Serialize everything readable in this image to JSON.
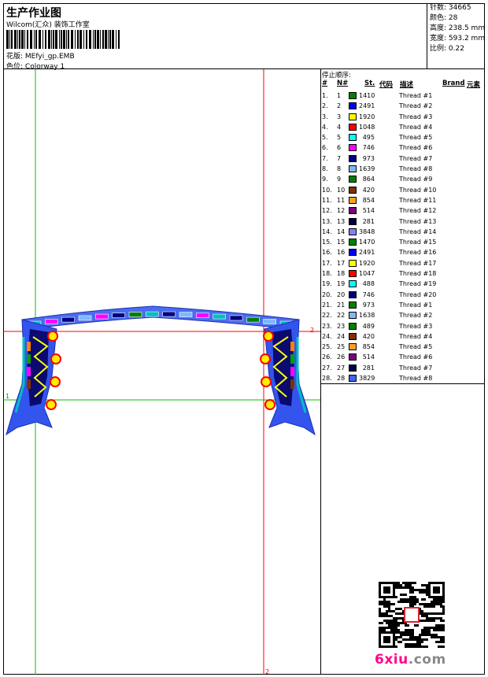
{
  "header": {
    "title": "生产作业图",
    "company": "Wilcom(汇众) 装饰工作室",
    "design_label": "花版:",
    "design_value": "MEfyi_gp.EMB",
    "colorway_label": "色位:",
    "colorway_value": "Colorway 1"
  },
  "stats": {
    "stitches_label": "针数:",
    "stitches_value": "34665",
    "colors_label": "颜色:",
    "colors_value": "28",
    "height_label": "高度:",
    "height_value": "238.5 mm",
    "width_label": "宽度:",
    "width_value": "593.2 mm",
    "scale_label": "比例:",
    "scale_value": "0.22"
  },
  "canvas": {
    "guide_colors": {
      "vertical_green": "#00c000",
      "vertical_red": "#ff0000",
      "horizontal_red": "#ff0000",
      "horizontal_green": "#00c000"
    },
    "markers": {
      "top_right": "2",
      "left_mid": "1",
      "bottom": "2"
    }
  },
  "sequence": {
    "title": "停止顺序:",
    "columns": {
      "num": "#",
      "no": "N#",
      "st": "St.",
      "code": "代码",
      "desc": "描述",
      "brand": "Brand",
      "element": "元素"
    },
    "rows": [
      {
        "n": "1.",
        "no": "1",
        "color": "#008000",
        "st": "1410",
        "desc": "Thread #1"
      },
      {
        "n": "2.",
        "no": "2",
        "color": "#0000ff",
        "st": "2491",
        "desc": "Thread #2"
      },
      {
        "n": "3.",
        "no": "3",
        "color": "#ffff00",
        "st": "1920",
        "desc": "Thread #3"
      },
      {
        "n": "4.",
        "no": "4",
        "color": "#ff0000",
        "st": "1048",
        "desc": "Thread #4"
      },
      {
        "n": "5.",
        "no": "5",
        "color": "#00ffff",
        "st": "495",
        "desc": "Thread #5"
      },
      {
        "n": "6.",
        "no": "6",
        "color": "#ff00ff",
        "st": "746",
        "desc": "Thread #6"
      },
      {
        "n": "7.",
        "no": "7",
        "color": "#000080",
        "st": "973",
        "desc": "Thread #7"
      },
      {
        "n": "8.",
        "no": "8",
        "color": "#7fb8ff",
        "st": "1639",
        "desc": "Thread #8"
      },
      {
        "n": "9.",
        "no": "9",
        "color": "#008000",
        "st": "864",
        "desc": "Thread #9"
      },
      {
        "n": "10.",
        "no": "10",
        "color": "#803000",
        "st": "420",
        "desc": "Thread #10"
      },
      {
        "n": "11.",
        "no": "11",
        "color": "#ffa020",
        "st": "854",
        "desc": "Thread #11"
      },
      {
        "n": "12.",
        "no": "12",
        "color": "#800080",
        "st": "514",
        "desc": "Thread #12"
      },
      {
        "n": "13.",
        "no": "13",
        "color": "#000040",
        "st": "281",
        "desc": "Thread #13"
      },
      {
        "n": "14.",
        "no": "14",
        "color": "#8080ff",
        "st": "3848",
        "desc": "Thread #14"
      },
      {
        "n": "15.",
        "no": "15",
        "color": "#008000",
        "st": "1470",
        "desc": "Thread #15"
      },
      {
        "n": "16.",
        "no": "16",
        "color": "#0000ff",
        "st": "2491",
        "desc": "Thread #16"
      },
      {
        "n": "17.",
        "no": "17",
        "color": "#ffff00",
        "st": "1920",
        "desc": "Thread #17"
      },
      {
        "n": "18.",
        "no": "18",
        "color": "#ff0000",
        "st": "1047",
        "desc": "Thread #18"
      },
      {
        "n": "19.",
        "no": "19",
        "color": "#00ffff",
        "st": "488",
        "desc": "Thread #19"
      },
      {
        "n": "20.",
        "no": "20",
        "color": "#000080",
        "st": "746",
        "desc": "Thread #20"
      },
      {
        "n": "21.",
        "no": "21",
        "color": "#008000",
        "st": "973",
        "desc": "Thread #1"
      },
      {
        "n": "22.",
        "no": "22",
        "color": "#7fb8ff",
        "st": "1638",
        "desc": "Thread #2"
      },
      {
        "n": "23.",
        "no": "23",
        "color": "#008000",
        "st": "489",
        "desc": "Thread #3"
      },
      {
        "n": "24.",
        "no": "24",
        "color": "#803000",
        "st": "420",
        "desc": "Thread #4"
      },
      {
        "n": "25.",
        "no": "25",
        "color": "#ffa020",
        "st": "854",
        "desc": "Thread #5"
      },
      {
        "n": "26.",
        "no": "26",
        "color": "#800080",
        "st": "514",
        "desc": "Thread #6"
      },
      {
        "n": "27.",
        "no": "27",
        "color": "#000040",
        "st": "281",
        "desc": "Thread #7"
      },
      {
        "n": "28.",
        "no": "28",
        "color": "#4060ff",
        "st": "3829",
        "desc": "Thread #8"
      }
    ]
  },
  "watermark": {
    "brand": "6xiu",
    "domain": ".com"
  }
}
